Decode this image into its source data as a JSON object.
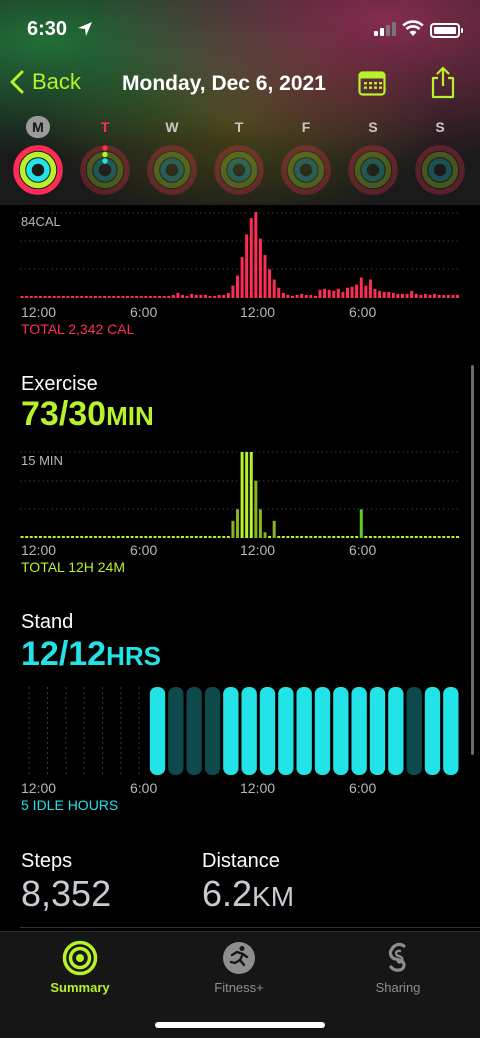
{
  "status_bar": {
    "time": "6:30"
  },
  "nav": {
    "back_label": "Back",
    "title": "Monday, Dec 6, 2021",
    "calendar_icon": "calendar-icon",
    "share_icon": "share-icon"
  },
  "week": {
    "days": [
      {
        "label": "M",
        "selected": true
      },
      {
        "label": "T",
        "selected": false
      },
      {
        "label": "W",
        "selected": false
      },
      {
        "label": "T",
        "selected": false
      },
      {
        "label": "F",
        "selected": false
      },
      {
        "label": "S",
        "selected": false
      },
      {
        "label": "S",
        "selected": false
      }
    ]
  },
  "colors": {
    "move": "#ff2d55",
    "exercise": "#b7f22a",
    "stand": "#22e3e8",
    "stand_dim": "#0e4a4c"
  },
  "move": {
    "top_caption": "84CAL",
    "ticks": [
      "12:00",
      "6:00",
      "12:00",
      "6:00"
    ],
    "total": "TOTAL 2,342 CAL"
  },
  "exercise": {
    "label": "Exercise",
    "value": "73/30",
    "unit": "MIN",
    "top_caption": "15 MIN",
    "ticks": [
      "12:00",
      "6:00",
      "12:00",
      "6:00"
    ],
    "total": "TOTAL 12H 24M"
  },
  "stand": {
    "label": "Stand",
    "value": "12/12",
    "unit": "HRS",
    "ticks": [
      "12:00",
      "6:00",
      "12:00",
      "6:00"
    ],
    "total": "5 IDLE HOURS"
  },
  "steps": {
    "label": "Steps",
    "value": "8,352"
  },
  "distance": {
    "label": "Distance",
    "value": "6.2",
    "unit": "KM"
  },
  "chart_data": [
    {
      "type": "bar",
      "title": "",
      "top_label": "84CAL",
      "x_ticks": [
        "12:00",
        "6:00",
        "12:00",
        "6:00"
      ],
      "bins": 96,
      "ylim": [
        0,
        84
      ],
      "values": [
        2,
        2,
        2,
        2,
        2,
        2,
        2,
        2,
        2,
        2,
        2,
        2,
        2,
        2,
        2,
        2,
        2,
        2,
        2,
        2,
        2,
        2,
        2,
        2,
        2,
        2,
        2,
        2,
        2,
        2,
        2,
        2,
        2,
        3,
        5,
        3,
        2,
        4,
        3,
        3,
        3,
        2,
        2,
        3,
        3,
        5,
        12,
        22,
        40,
        62,
        78,
        84,
        58,
        42,
        28,
        18,
        10,
        5,
        3,
        2,
        3,
        4,
        3,
        3,
        2,
        8,
        9,
        8,
        7,
        9,
        6,
        10,
        11,
        13,
        20,
        12,
        18,
        9,
        7,
        6,
        6,
        5,
        4,
        4,
        4,
        7,
        4,
        3,
        4,
        3,
        4,
        3,
        3,
        3,
        3,
        3
      ],
      "total_label": "TOTAL 2,342 CAL"
    },
    {
      "type": "bar",
      "title": "",
      "top_label": "15 MIN",
      "x_ticks": [
        "12:00",
        "6:00",
        "12:00",
        "6:00"
      ],
      "bins": 96,
      "ylim": [
        0,
        15
      ],
      "values": [
        0,
        0,
        0,
        0,
        0,
        0,
        0,
        0,
        0,
        0,
        0,
        0,
        0,
        0,
        0,
        0,
        0,
        0,
        0,
        0,
        0,
        0,
        0,
        0,
        0,
        0,
        0,
        0,
        0,
        0,
        0,
        0,
        0,
        0,
        0,
        0,
        0,
        0,
        0,
        0,
        0,
        0,
        0,
        0,
        0,
        0,
        3,
        5,
        15,
        15,
        15,
        10,
        5,
        1,
        0,
        3,
        0,
        0,
        0,
        0,
        0,
        0,
        0,
        0,
        0,
        0,
        0,
        0,
        0,
        0,
        0,
        0,
        0,
        0,
        0,
        0,
        0,
        0,
        0,
        0,
        0,
        0,
        0,
        0,
        0,
        0,
        0,
        0,
        0,
        0,
        0,
        0,
        0,
        0,
        0,
        0
      ],
      "special": [
        {
          "index": 74,
          "value": 5,
          "color": "#5cd01e"
        }
      ],
      "total_label": "TOTAL 12H 24M"
    },
    {
      "type": "bar",
      "title": "",
      "x_ticks": [
        "12:00",
        "6:00",
        "12:00",
        "6:00"
      ],
      "hours": 24,
      "stood": [
        0,
        0,
        0,
        0,
        0,
        0,
        0,
        1,
        0,
        0,
        0,
        1,
        1,
        1,
        1,
        1,
        1,
        1,
        1,
        1,
        1,
        0,
        1,
        1
      ],
      "active_window": [
        7,
        24
      ],
      "total_label": "5 IDLE HOURS"
    }
  ],
  "tabs": [
    {
      "label": "Summary",
      "icon": "activity-rings-icon",
      "active": true
    },
    {
      "label": "Fitness+",
      "icon": "runner-icon",
      "active": false
    },
    {
      "label": "Sharing",
      "icon": "sharing-icon",
      "active": false
    }
  ]
}
